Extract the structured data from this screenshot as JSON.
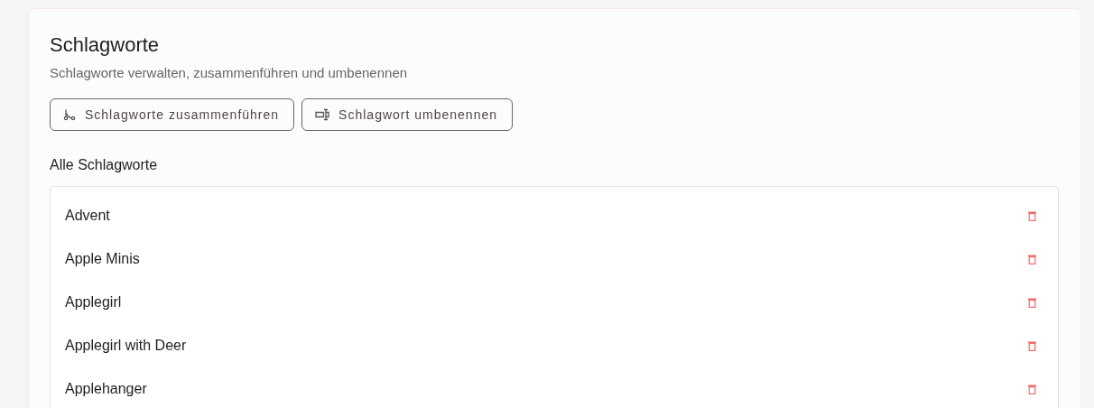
{
  "header": {
    "title": "Schlagworte",
    "subtitle": "Schlagworte verwalten, zusammenführen und umbenennen"
  },
  "actions": [
    {
      "kind": "merge",
      "label": "Schlagworte zusammenführen"
    },
    {
      "kind": "rename",
      "label": "Schlagwort umbenennen"
    }
  ],
  "list": {
    "title": "Alle Schlagworte",
    "items": [
      {
        "name": "Advent"
      },
      {
        "name": "Apple Minis"
      },
      {
        "name": "Applegirl"
      },
      {
        "name": "Applegirl with Deer"
      },
      {
        "name": "Applehanger"
      }
    ]
  }
}
